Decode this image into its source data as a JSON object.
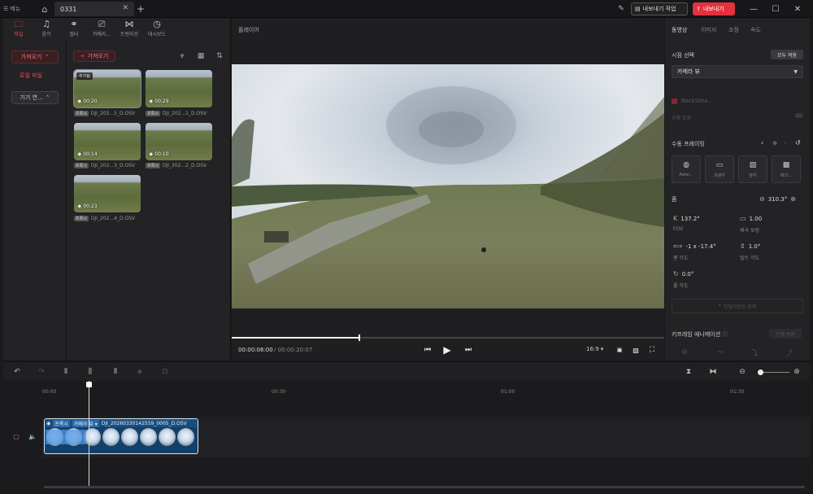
{
  "titlebar": {
    "menu_label": "메뉴",
    "tab_title": "0331",
    "export_job_label": "내보내기 작업",
    "export_label": "내보내기",
    "accent": "#e3313f"
  },
  "categories": [
    {
      "label": "파일",
      "icon": "folder-icon"
    },
    {
      "label": "음악",
      "icon": "music-icon"
    },
    {
      "label": "필터",
      "icon": "filter-icon"
    },
    {
      "label": "카메라...",
      "icon": "camera-icon"
    },
    {
      "label": "트랜지션",
      "icon": "transition-icon"
    },
    {
      "label": "대시보드",
      "icon": "dashboard-icon"
    }
  ],
  "leftnav": {
    "import_label": "가져오기",
    "local_label": "로컬 파일",
    "device_label": "기기 연..."
  },
  "media": {
    "import_label": "가져오기",
    "items": [
      {
        "duration": "00:20",
        "name": "DJI_202...5_D.OSV",
        "tag": "프록시",
        "added": "추가됨"
      },
      {
        "duration": "00:29",
        "name": "DJI_202...1_D.OSV",
        "tag": "프록시",
        "added": ""
      },
      {
        "duration": "00:14",
        "name": "DJI_202...3_D.OSV",
        "tag": "프록시",
        "added": ""
      },
      {
        "duration": "00:10",
        "name": "DJI_202...2_D.OSV",
        "tag": "프록시",
        "added": ""
      },
      {
        "duration": "00:23",
        "name": "DJI_202...4_D.OSV",
        "tag": "프록시",
        "added": ""
      }
    ]
  },
  "player": {
    "title": "플레이어",
    "current_time": "00:00:06:00",
    "total_time": "/ 00:00:20:07",
    "aspect_ratio": "16:9",
    "progress": 0.297
  },
  "right": {
    "tabs": [
      "동영상",
      "이미지",
      "조정",
      "속도"
    ],
    "viewpoint_title": "시점 선택",
    "apply_all": "모두 적용",
    "view_value": "카메라 뷰",
    "rocksteady": "RockStea...",
    "horizon_lock": "수평 조정",
    "manual_framing": "수동 프레이밍",
    "frame_modes": [
      "Aster...",
      "초광각",
      "광각",
      "매크..."
    ],
    "zoom_label": "줌",
    "zoom_value": "310.3°",
    "fov_value": "137.2°",
    "fov_label": "FOV",
    "distortion_value": "1.00",
    "distortion_label": "왜곡 보정",
    "pan_value": "-1  x  -17.4°",
    "pan_label": "팬 각도",
    "tilt_value": "1.0°",
    "tilt_label": "틸트 각도",
    "roll_value": "0.0°",
    "roll_label": "롤 각도",
    "interpolate": "인텔리전트 추적",
    "keyframe_title": "키프레임 애니메이션",
    "keyframe_apply_all": "전체 적용"
  },
  "timeline": {
    "ruler": [
      "00:00",
      "00:30",
      "01:00",
      "01:30"
    ],
    "clip_tag": "프록시",
    "clip_view": "카메라 뷰",
    "clip_name": "DJI_20260330142559_0005_D.OSV"
  }
}
